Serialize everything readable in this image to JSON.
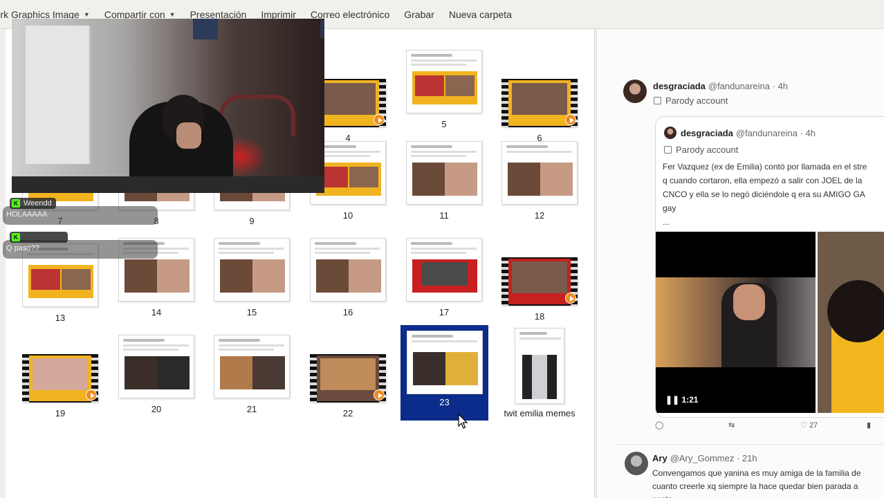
{
  "toolbar": {
    "items": [
      {
        "label": "rork Graphics Image",
        "caret": true
      },
      {
        "label": "Compartir con",
        "caret": true
      },
      {
        "label": "Presentación",
        "caret": false
      },
      {
        "label": "Imprimir",
        "caret": false
      },
      {
        "label": "Correo electrónico",
        "caret": false
      },
      {
        "label": "Grabar",
        "caret": false
      },
      {
        "label": "Nueva carpeta",
        "caret": false
      }
    ]
  },
  "explorer": {
    "files": [
      {
        "label": "4"
      },
      {
        "label": "5"
      },
      {
        "label": "6"
      },
      {
        "label": "7"
      },
      {
        "label": "8"
      },
      {
        "label": "9"
      },
      {
        "label": "10"
      },
      {
        "label": "11"
      },
      {
        "label": "12"
      },
      {
        "label": "13"
      },
      {
        "label": "14"
      },
      {
        "label": "15"
      },
      {
        "label": "16"
      },
      {
        "label": "17"
      },
      {
        "label": "18"
      },
      {
        "label": "19"
      },
      {
        "label": "20"
      },
      {
        "label": "21"
      },
      {
        "label": "22"
      },
      {
        "label": "23"
      },
      {
        "label": "twit emilia memes"
      }
    ],
    "selected": "23"
  },
  "chat": [
    {
      "user": "Weendd",
      "message": "HOLAAAAA",
      "user_color": "#e8e8e8"
    },
    {
      "user": "",
      "message": "Q paso??",
      "user_color": "#e0342f"
    }
  ],
  "twitter": {
    "tweet": {
      "name": "desgraciada",
      "handle": "@fandunareina · 4h",
      "label": "Parody account"
    },
    "quoted": {
      "name": "desgraciada",
      "handle": "@fandunareina · 4h",
      "label": "Parody account",
      "text_lines": [
        "Fer Vazquez (ex de Emilia) contó por llamada en el stre",
        "q cuando cortaron, ella empezó a salir con JOEL de la",
        "CNCO y ella se lo negó diciéndole q era su AMIGO GA",
        "gay",
        "..."
      ],
      "video_time": "1:21"
    },
    "actions": {
      "likes": "27"
    },
    "reply": {
      "name": "Ary",
      "handle": "@Ary_Gommez · 21h",
      "text_lines": [
        "Convengamos que yanina es muy amiga de la familia de",
        "cuanto creerle xq siempre la hace quedar bien parada a",
        "santa"
      ]
    }
  }
}
